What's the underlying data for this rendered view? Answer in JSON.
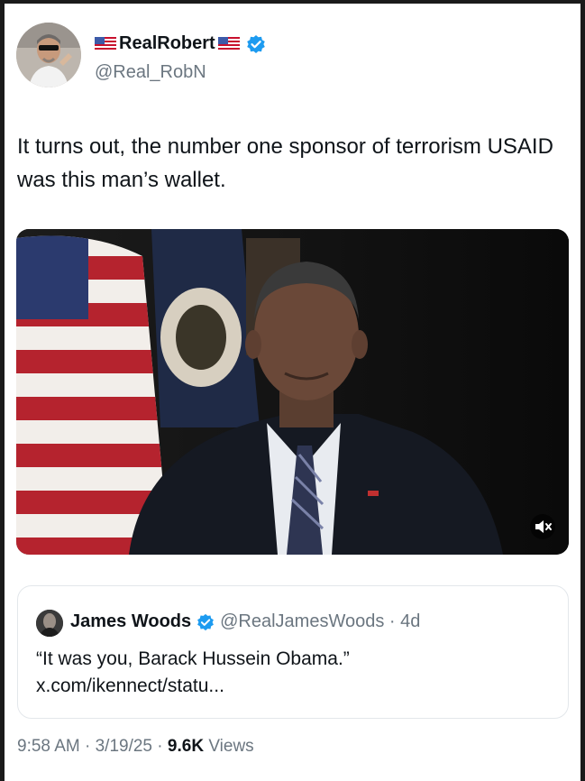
{
  "author": {
    "display_name": "RealRobert",
    "handle": "@Real_RobN"
  },
  "tweet": {
    "text": "It turns out, the number one sponsor of terrorism USAID was this man’s wallet."
  },
  "quoted": {
    "name": "James Woods",
    "meta": "@RealJamesWoods · 4d",
    "text": "“It was you, Barack Hussein Obama.” x.com/ikennect/statu..."
  },
  "footer": {
    "time": "9:58 AM",
    "date": "3/19/25",
    "views_count": "9.6K",
    "views_label": "Views"
  },
  "colors": {
    "verified": "#1d9bf0",
    "text": "#0f1419",
    "muted": "#6b7680"
  },
  "icons": [
    "us-flag-icon",
    "verified-badge-icon",
    "mute-icon"
  ]
}
